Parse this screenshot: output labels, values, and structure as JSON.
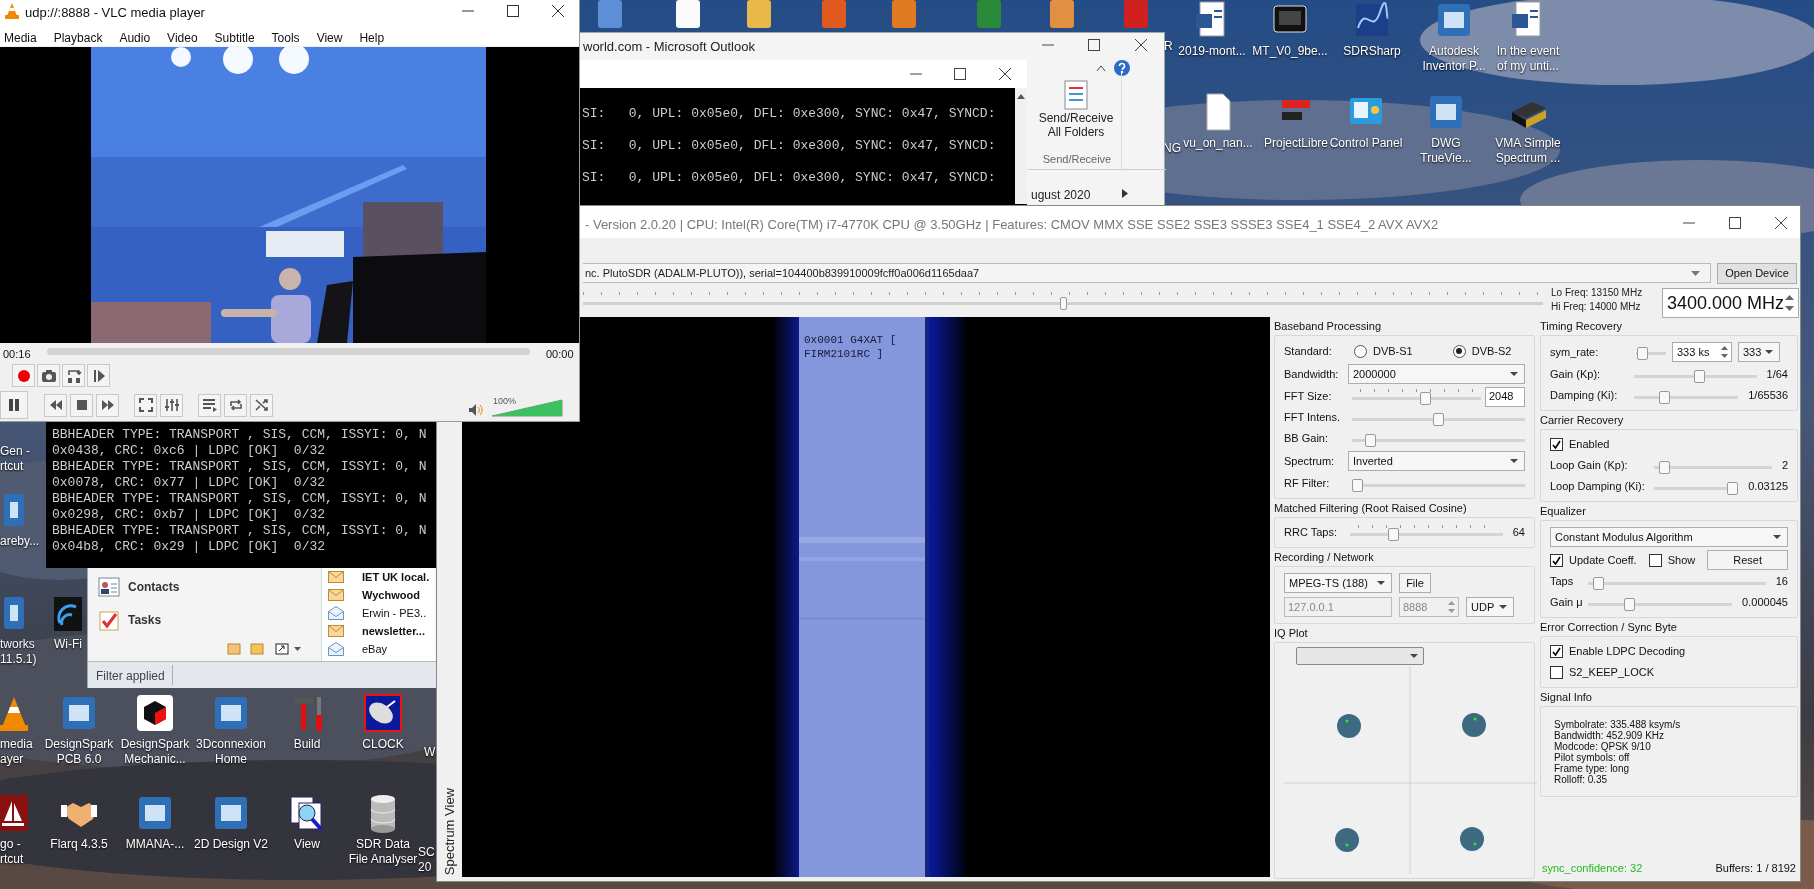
{
  "desktop_icons": [
    {
      "label": "R"
    },
    {
      "label": "2019-mont..."
    },
    {
      "label": "MT_V0_9be..."
    },
    {
      "label": "SDRSharp"
    },
    {
      "label": "Autodesk Inventor P..."
    },
    {
      "label": "In the event of my unti..."
    },
    {
      "label": "NG"
    },
    {
      "label": "vu_on_nan..."
    },
    {
      "label": "ProjectLibre"
    },
    {
      "label": "Control Panel"
    },
    {
      "label": "DWG TrueVie..."
    },
    {
      "label": "VMA Simple Spectrum ..."
    },
    {
      "label": "Gen - rtcut"
    },
    {
      "label": "areby..."
    },
    {
      "label": "tworks 11.5.1)"
    },
    {
      "label": "Wi-Fi"
    },
    {
      "label": "media ayer"
    },
    {
      "label": "DesignSpark PCB 6.0"
    },
    {
      "label": "DesignSpark Mechanic..."
    },
    {
      "label": "3Dconnexion Home"
    },
    {
      "label": "Build"
    },
    {
      "label": "CLOCK"
    },
    {
      "label": "W"
    },
    {
      "label": "go - rtcut"
    },
    {
      "label": "Flarq 4.3.5"
    },
    {
      "label": "MMANA-..."
    },
    {
      "label": "2D Design V2"
    },
    {
      "label": "View"
    },
    {
      "label": "SDR Data File Analyser"
    },
    {
      "label": "SC 20"
    }
  ],
  "outlook": {
    "title": "world.com - Microsoft Outlook",
    "ribbon_button": "Send/Receive All Folders",
    "ribbon_group": "Send/Receive",
    "calendar_month": "ugust 2020",
    "nav": [
      "Contacts",
      "Tasks"
    ],
    "mail": [
      {
        "from": "IET UK local.",
        "unread": true
      },
      {
        "from": "Wychwood",
        "unread": true
      },
      {
        "from": "Erwin - PE3..",
        "unread": false
      },
      {
        "from": "newsletter...",
        "unread": true
      },
      {
        "from": "eBay",
        "unread": false
      }
    ],
    "status": "Filter applied"
  },
  "console": {
    "top_lines": [
      "SI:   0, UPL: 0x05e0, DFL: 0xe300, SYNC: 0x47, SYNCD:",
      "SI:   0, UPL: 0x05e0, DFL: 0xe300, SYNC: 0x47, SYNCD:",
      "SI:   0, UPL: 0x05e0, DFL: 0xe300, SYNC: 0x47, SYNCD:"
    ],
    "bottom_lines": [
      "BBHEADER TYPE: TRANSPORT , SIS, CCM, ISSYI: 0, N",
      "0x0438, CRC: 0xc6 | LDPC [OK]  0/32",
      "BBHEADER TYPE: TRANSPORT , SIS, CCM, ISSYI: 0, N",
      "0x0078, CRC: 0x77 | LDPC [OK]  0/32",
      "BBHEADER TYPE: TRANSPORT , SIS, CCM, ISSYI: 0, N",
      "0x0298, CRC: 0xb7 | LDPC [OK]  0/32",
      "BBHEADER TYPE: TRANSPORT , SIS, CCM, ISSYI: 0, N",
      "0x04b8, CRC: 0x29 | LDPC [OK]  0/32"
    ]
  },
  "sdr": {
    "title": "- Version 2.0.20 | CPU: Intel(R) Core(TM) i7-4770K CPU @ 3.50GHz | Features: CMOV MMX SSE SSE2 SSE3 SSSE3 SSE4_1 SSE4_2 AVX AVX2",
    "device": "nc. PlutoSDR (ADALM-PLUTO)), serial=104400b839910009fcff0a006d1165daa7",
    "open_device": "Open Device",
    "tuning": {
      "level": 0.5
    },
    "lo_freq": "Lo Freq: 13150 MHz",
    "hi_freq": "Hi Freq: 14000 MHz",
    "frequency": "3400.000 MHz",
    "spectrum_label": "Spectrum View",
    "spectrum_overlay": [
      "0x0001 G4XAT [",
      "FIRM2101RC ]"
    ],
    "left_groups": [
      {
        "title": "Baseband Processing",
        "rows": [
          {
            "kind": "radio",
            "label": "Standard:",
            "options": [
              {
                "label": "DVB-S1",
                "selected": false
              },
              {
                "label": "DVB-S2",
                "selected": true
              }
            ]
          },
          {
            "kind": "combo",
            "label": "Bandwidth:",
            "value": "2000000"
          },
          {
            "kind": "slider",
            "label": "FFT Size:",
            "level": 0.58,
            "ticks": true,
            "field": "2048"
          },
          {
            "kind": "slider",
            "label": "FFT Intens.",
            "level": 0.5
          },
          {
            "kind": "slider",
            "label": "BB Gain:",
            "level": 0.08
          },
          {
            "kind": "combo",
            "label": "Spectrum:",
            "value": "Inverted"
          },
          {
            "kind": "slider",
            "label": "RF Filter:",
            "level": 0
          }
        ]
      },
      {
        "title": "Matched Filtering (Root Raised Cosine)",
        "rows": [
          {
            "kind": "slider",
            "label": "RRC Taps:",
            "level": 0.27,
            "ticks": true,
            "reading": "64"
          }
        ]
      },
      {
        "title": "Recording / Network",
        "rows": [
          {
            "kind": "record",
            "format": "MPEG-TS (188)",
            "button": "File",
            "address": "127.0.0.1",
            "port": "8888",
            "protocol": "UDP"
          }
        ]
      },
      {
        "title": "IQ Plot",
        "rows": [
          {
            "kind": "iq"
          }
        ]
      }
    ],
    "right_groups": [
      {
        "title": "Timing Recovery",
        "rows": [
          {
            "kind": "symrate",
            "label": "sym_rate:",
            "level": 0.05,
            "spin": "333 ks",
            "combo": "333"
          },
          {
            "kind": "slider",
            "label": "Gain (Kp):",
            "level": 0.54,
            "reading": "1/64"
          },
          {
            "kind": "slider",
            "label": "Damping (Ki):",
            "level": 0.27,
            "reading": "1/65536"
          }
        ]
      },
      {
        "title": "Carrier Recovery",
        "rows": [
          {
            "kind": "check",
            "label": "Enabled",
            "checked": true
          },
          {
            "kind": "slider",
            "label": "Loop Gain (Kp):",
            "level": 0.05,
            "reading": "2"
          },
          {
            "kind": "slider",
            "label": "Loop Damping (Ki):",
            "level": 1,
            "reading": "0.03125"
          }
        ]
      },
      {
        "title": "Equalizer",
        "rows": [
          {
            "kind": "combo",
            "value": "Constant Modulus Algorithm"
          },
          {
            "kind": "checks",
            "items": [
              {
                "label": "Update Coeff.",
                "checked": true
              },
              {
                "label": "Show",
                "checked": false
              }
            ],
            "button": "Reset"
          },
          {
            "kind": "slider",
            "label": "Taps",
            "level": 0.03,
            "reading": "16"
          },
          {
            "kind": "slider",
            "label": "Gain μ",
            "level": 0.27,
            "reading": "0.000045"
          }
        ]
      },
      {
        "title": "Error Correction / Sync Byte",
        "rows": [
          {
            "kind": "check",
            "label": "Enable LDPC Decoding",
            "checked": true
          },
          {
            "kind": "check",
            "label": "S2_KEEP_LOCK",
            "checked": false
          }
        ]
      },
      {
        "title": "Signal Info",
        "rows": [
          {
            "kind": "info",
            "lines": [
              "Symbolrate: 335.488 ksym/s",
              "Bandwidth: 452.909 KHz",
              "Modcode: QPSK 9/10",
              "Pilot symbols: off",
              "Frame type: long",
              "Rolloff: 0.35"
            ]
          }
        ]
      }
    ],
    "sync_confidence": "sync_confidence: 32",
    "buffers": "Buffers: 1 / 8192"
  },
  "vlc": {
    "title": "udp://:8888 - VLC media player",
    "menu": [
      "Media",
      "Playback",
      "Audio",
      "Video",
      "Subtitle",
      "Tools",
      "View",
      "Help"
    ],
    "elapsed": "00:16",
    "total": "00:00",
    "volume": {
      "label": "100%",
      "level": 1
    }
  }
}
